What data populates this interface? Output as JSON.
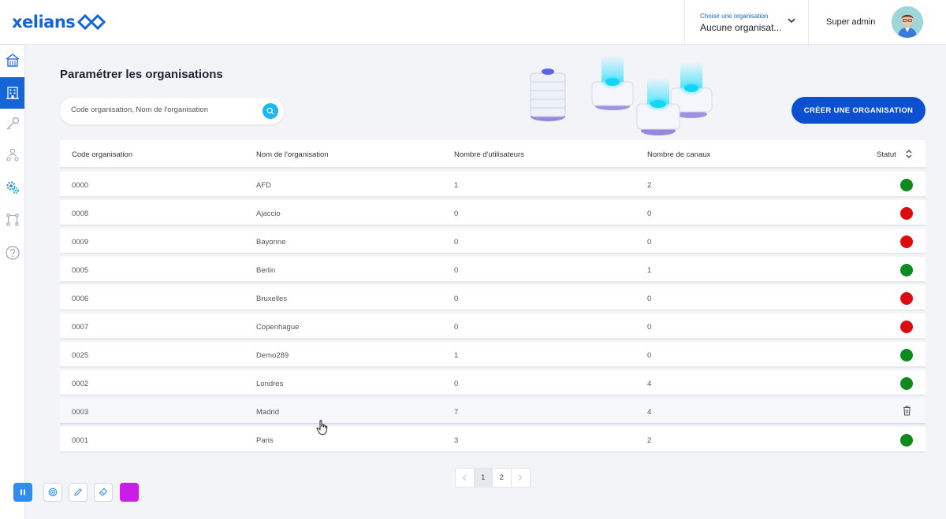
{
  "brand": {
    "name": "xelians"
  },
  "header": {
    "org_select_label": "Choisir une organisation",
    "org_select_value": "Aucune organisat...",
    "user_name": "Super admin"
  },
  "sidebar": {
    "items": [
      {
        "icon": "home-icon"
      },
      {
        "icon": "building-icon",
        "active": true
      },
      {
        "icon": "key-icon"
      },
      {
        "icon": "users-icon"
      },
      {
        "icon": "settings-icon"
      },
      {
        "icon": "workflow-icon"
      },
      {
        "icon": "help-icon"
      }
    ]
  },
  "main": {
    "title": "Paramétrer les organisations",
    "search_placeholder": "Code organisation, Nom de l'organisation",
    "create_button": "CRÉER UNE ORGANISATION"
  },
  "table": {
    "columns": [
      "Code organisation",
      "Nom de l'organisation",
      "Nombre d'utilisateurs",
      "Nombre de canaux",
      "Statut"
    ],
    "rows": [
      {
        "code": "0000",
        "name": "AFD",
        "users": "1",
        "channels": "2",
        "status": "active"
      },
      {
        "code": "0008",
        "name": "Ajaccio",
        "users": "0",
        "channels": "0",
        "status": "inactive"
      },
      {
        "code": "0009",
        "name": "Bayonne",
        "users": "0",
        "channels": "0",
        "status": "inactive"
      },
      {
        "code": "0005",
        "name": "Berlin",
        "users": "0",
        "channels": "1",
        "status": "active"
      },
      {
        "code": "0006",
        "name": "Bruxelles",
        "users": "0",
        "channels": "0",
        "status": "inactive"
      },
      {
        "code": "0007",
        "name": "Copenhague",
        "users": "0",
        "channels": "0",
        "status": "inactive"
      },
      {
        "code": "0025",
        "name": "Demo289",
        "users": "1",
        "channels": "0",
        "status": "active"
      },
      {
        "code": "0002",
        "name": "Londres",
        "users": "0",
        "channels": "4",
        "status": "active"
      },
      {
        "code": "0003",
        "name": "Madrid",
        "users": "7",
        "channels": "4",
        "status": "hover-delete"
      },
      {
        "code": "0001",
        "name": "Paris",
        "users": "3",
        "channels": "2",
        "status": "active"
      }
    ]
  },
  "pagination": {
    "pages": [
      "1",
      "2"
    ],
    "current": "1"
  },
  "colors": {
    "primary": "#1565d8",
    "button": "#0c4fd1",
    "accent": "#1db6ee",
    "status_active": "#0f8a1e",
    "status_inactive": "#dd0c0c",
    "toolbar_pause": "#2d8ef0",
    "toolbar_color_swatch": "#cc1de8"
  },
  "toolbar": {
    "tools": [
      "pause-icon",
      "target-icon",
      "pencil-icon",
      "eraser-icon",
      "color-swatch"
    ]
  }
}
